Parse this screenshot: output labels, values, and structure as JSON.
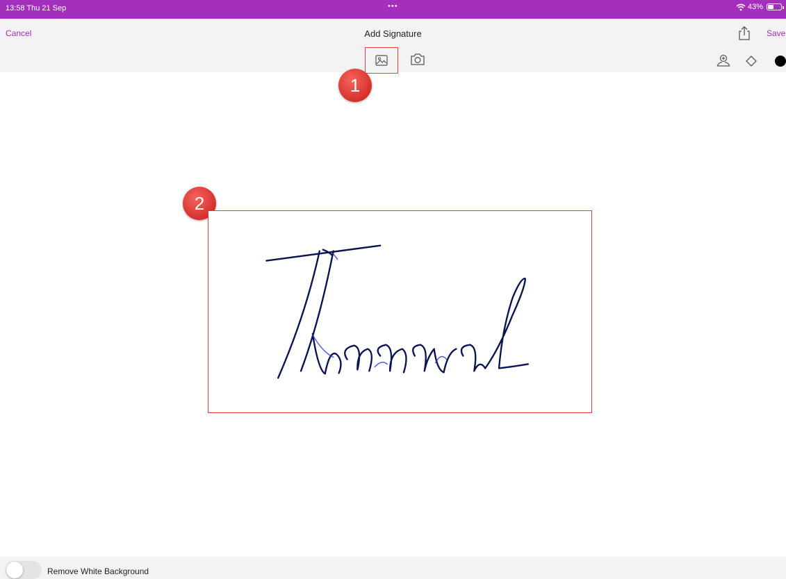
{
  "status_bar": {
    "time": "13:58  Thu 21 Sep",
    "dots": "•••",
    "wifi_icon": "wifi-icon",
    "battery_text": "43%",
    "battery_level": 0.43
  },
  "nav": {
    "cancel_label": "Cancel",
    "title": "Add Signature",
    "share_icon": "share-icon",
    "save_label": "Save"
  },
  "toolbar": {
    "image_icon": "image-icon",
    "camera_icon": "camera-icon",
    "add_person_icon": "add-person-icon",
    "eraser_icon": "eraser-icon",
    "color": "#000000"
  },
  "annotations": {
    "marker_1": "1",
    "marker_2": "2"
  },
  "signature": {
    "text": "Thanawal",
    "ink_color": "#0a1450"
  },
  "bottom": {
    "toggle_label": "Remove White Background",
    "toggle_on": false
  },
  "colors": {
    "accent": "#9d2fb5",
    "status_bar": "#a42fbc",
    "highlight": "#d9403c"
  }
}
